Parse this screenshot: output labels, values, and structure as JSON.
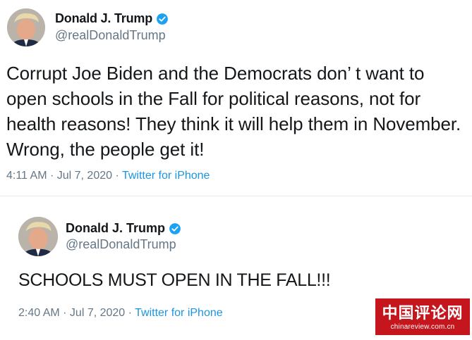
{
  "tweets": [
    {
      "display_name": "Donald J. Trump",
      "handle": "@realDonaldTrump",
      "text": "Corrupt Joe Biden and the Democrats don’  t want to open schools in the Fall for political reasons, not for health reasons! They think it will help them in November. Wrong, the people get it!",
      "time": "4:11 AM",
      "date": "Jul 7, 2020",
      "separator": " · ",
      "source": "Twitter for iPhone"
    },
    {
      "display_name": "Donald J. Trump",
      "handle": "@realDonaldTrump",
      "text": "SCHOOLS MUST OPEN IN THE FALL!!!",
      "time": "2:40 AM",
      "date": "Jul 7, 2020",
      "separator": " · ",
      "source": "Twitter for iPhone"
    }
  ],
  "watermark": {
    "title": "中国评论网",
    "url": "chinareview.com.cn"
  },
  "colors": {
    "verified": "#1da1f2",
    "source_link": "#1b95e0",
    "watermark_bg": "#c4161c",
    "muted": "#657786"
  },
  "icons": {
    "verified": "verified-badge-icon",
    "avatar": "profile-avatar"
  }
}
